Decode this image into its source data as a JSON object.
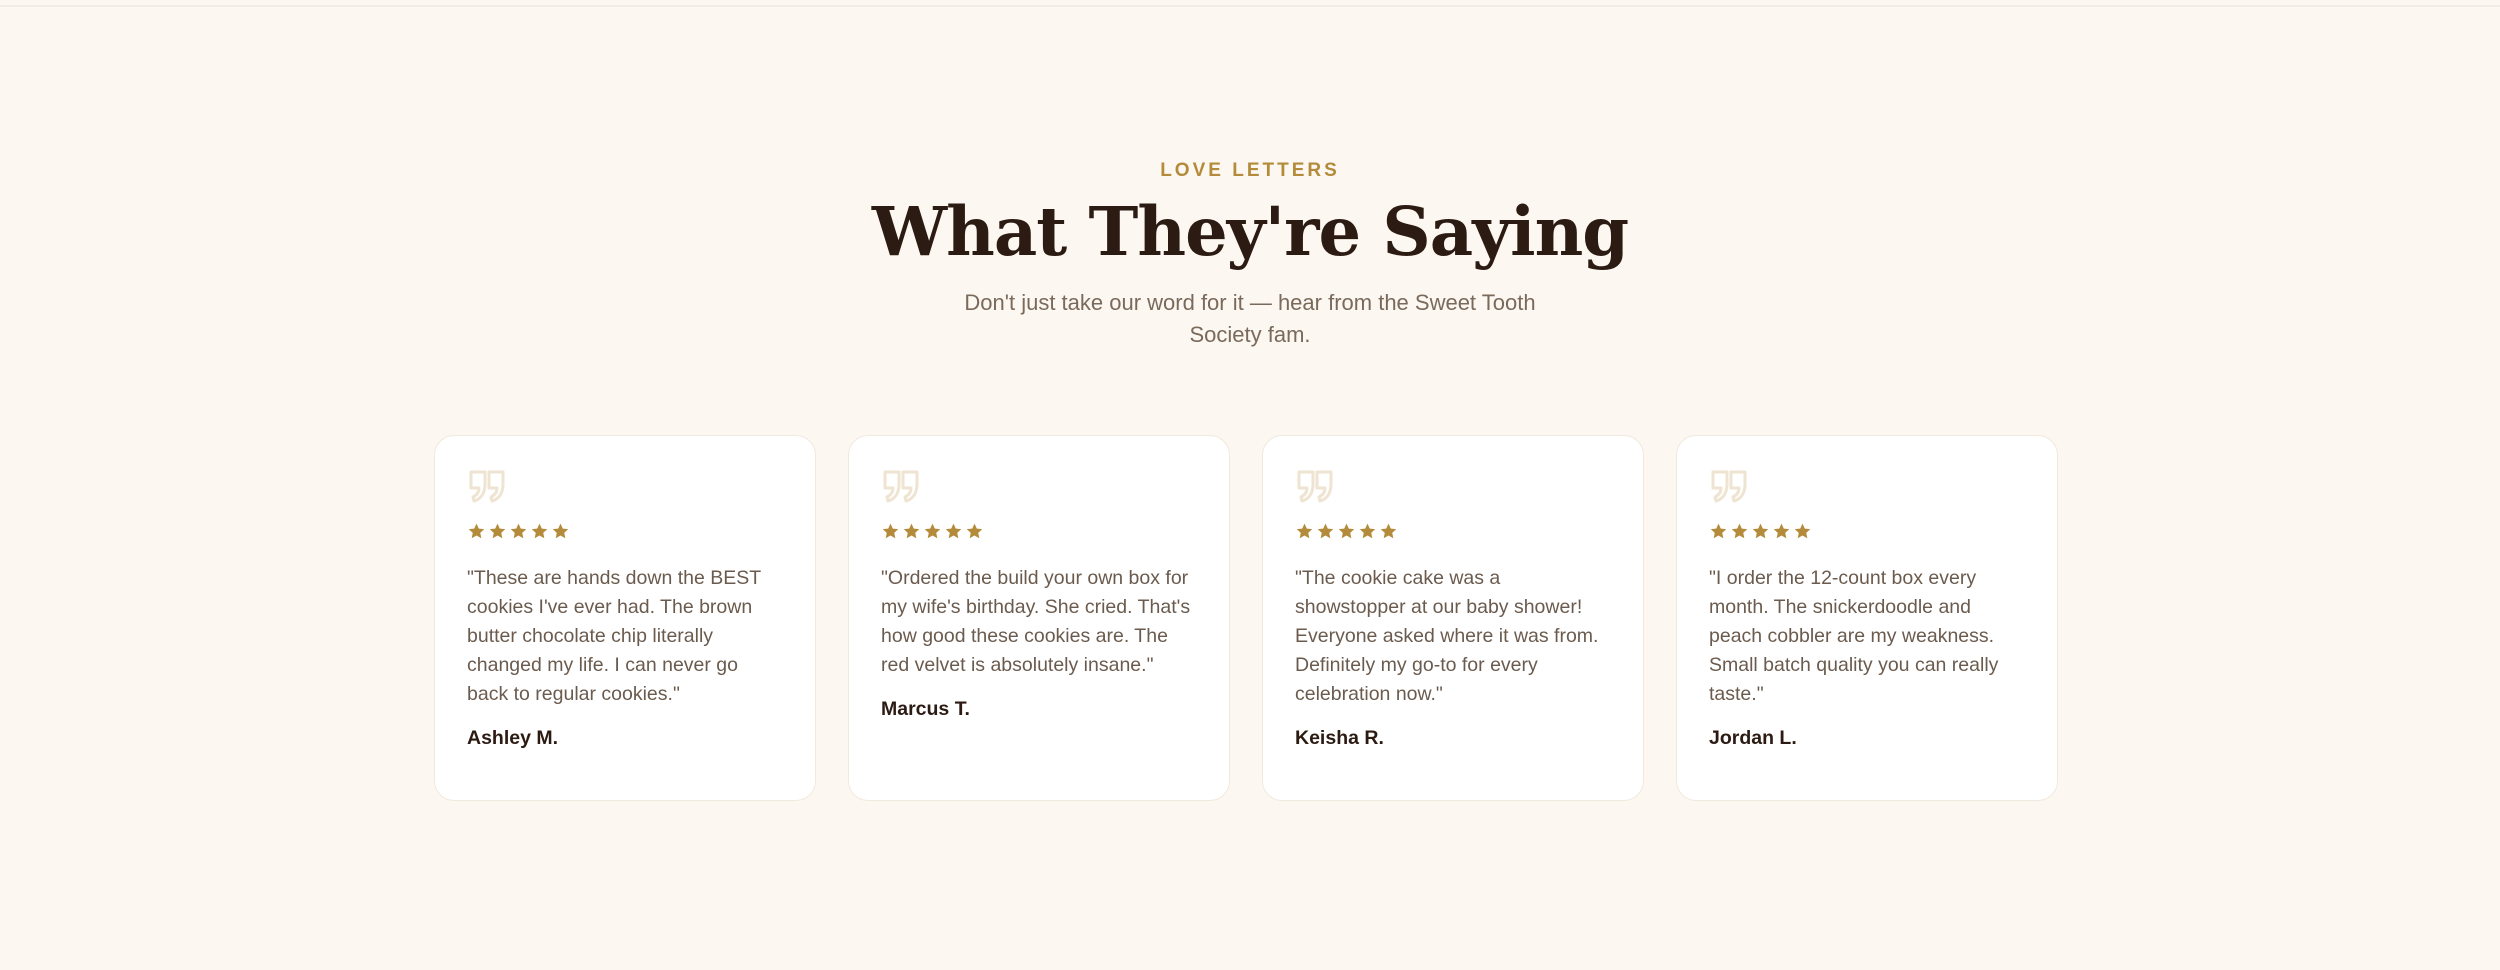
{
  "section": {
    "eyebrow": "LOVE LETTERS",
    "title": "What They're Saying",
    "subtitle": "Don't just take our word for it — hear from the Sweet Tooth Society fam."
  },
  "colors": {
    "background": "#fcf7f0",
    "accent_gold": "#b38b3a",
    "quote_icon": "#efe4d2",
    "heading": "#2c1b13",
    "body_text": "#6b5b4e"
  },
  "testimonials": [
    {
      "icon": "quote-icon",
      "rating": 5,
      "text": "\"These are hands down the BEST cookies I've ever had. The brown butter chocolate chip literally changed my life. I can never go back to regular cookies.\"",
      "author": "Ashley M."
    },
    {
      "icon": "quote-icon",
      "rating": 5,
      "text": "\"Ordered the build your own box for my wife's birthday. She cried. That's how good these cookies are. The red velvet is absolutely insane.\"",
      "author": "Marcus T."
    },
    {
      "icon": "quote-icon",
      "rating": 5,
      "text": "\"The cookie cake was a showstopper at our baby shower! Everyone asked where it was from. Definitely my go-to for every celebration now.\"",
      "author": "Keisha R."
    },
    {
      "icon": "quote-icon",
      "rating": 5,
      "text": "\"I order the 12-count box every month. The snickerdoodle and peach cobbler are my weakness. Small batch quality you can really taste.\"",
      "author": "Jordan L."
    }
  ]
}
